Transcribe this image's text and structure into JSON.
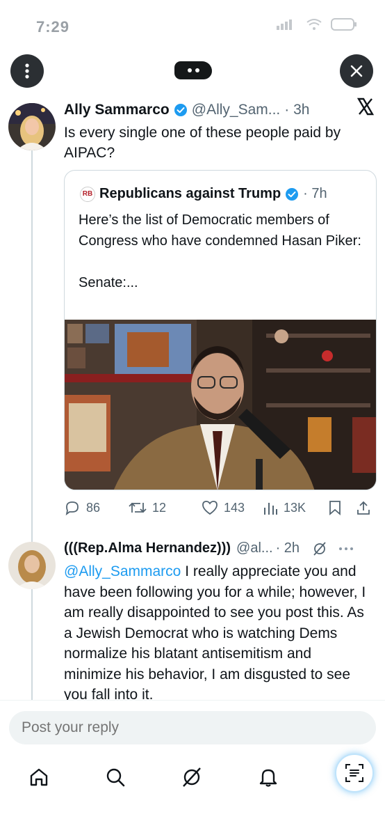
{
  "status_bar": {
    "time": "7:29"
  },
  "tweet": {
    "author_name": "Ally Sammarco",
    "handle": "@Ally_Sam...",
    "time": "· 3h",
    "text": "Is every single one of these people paid by AIPAC?",
    "quote": {
      "logo_text": "RB",
      "author_name": "Republicans against Trump",
      "time": "· 7h",
      "text": "Here’s the list of Democratic members of Congress who have condemned Hasan Piker:",
      "text_more": "Senate:..."
    },
    "actions": {
      "replies": "86",
      "retweets": "12",
      "likes": "143",
      "views": "13K"
    }
  },
  "reply": {
    "author_name": "(((Rep.Alma Hernandez)))",
    "handle": "@al...",
    "time": "· 2h",
    "mention": "@Ally_Sammarco",
    "text": " I really appreciate you and have been following you for a while; however, I am really disappointed to see you post this. As a Jewish Democrat who is watching Dems normalize his blatant antisemitism and minimize his behavior, I am disgusted to see you fall into it."
  },
  "reply_bar": {
    "placeholder": "Post your reply"
  },
  "colors": {
    "accent": "#1d9bf0",
    "text": "#0f1419",
    "muted": "#536471"
  },
  "icons": [
    "menu-icon",
    "close-icon",
    "x-logo-icon",
    "verified-icon",
    "reply-icon",
    "retweet-icon",
    "like-icon",
    "views-icon",
    "bookmark-icon",
    "share-icon",
    "grok-icon",
    "more-icon",
    "home-icon",
    "search-icon",
    "notifications-icon",
    "scan-icon"
  ]
}
